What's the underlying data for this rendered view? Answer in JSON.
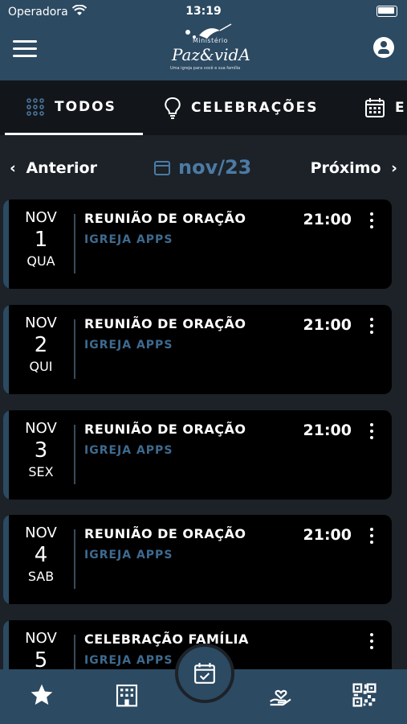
{
  "status": {
    "carrier": "Operadora",
    "time": "13:19"
  },
  "header": {
    "logo_small": "Ministério",
    "logo_main": "Paz&vidA",
    "logo_tagline": "Uma igreja para você e sua família"
  },
  "tabs": [
    {
      "label": "TODOS",
      "icon": "grid-icon",
      "active": true
    },
    {
      "label": "CELEBRAÇÕES",
      "icon": "lightbulb-icon"
    },
    {
      "label": "E",
      "icon": "calendar-icon"
    }
  ],
  "month_nav": {
    "prev": "Anterior",
    "current": "nov/23",
    "next": "Próximo"
  },
  "events": [
    {
      "month": "NOV",
      "day": "1",
      "weekday": "QUA",
      "title": "REUNIÃO DE ORAÇÃO",
      "subtitle": "IGREJA APPS",
      "time": "21:00"
    },
    {
      "month": "NOV",
      "day": "2",
      "weekday": "QUI",
      "title": "REUNIÃO DE ORAÇÃO",
      "subtitle": "IGREJA APPS",
      "time": "21:00"
    },
    {
      "month": "NOV",
      "day": "3",
      "weekday": "SEX",
      "title": "REUNIÃO DE ORAÇÃO",
      "subtitle": "IGREJA APPS",
      "time": "21:00"
    },
    {
      "month": "NOV",
      "day": "4",
      "weekday": "SAB",
      "title": "REUNIÃO DE ORAÇÃO",
      "subtitle": "IGREJA APPS",
      "time": "21:00"
    },
    {
      "month": "NOV",
      "day": "5",
      "weekday": "",
      "title": "CELEBRAÇÃO FAMÍLIA",
      "subtitle": "IGREJA APPS",
      "time": ""
    }
  ],
  "bottom_nav": [
    "star-icon",
    "building-icon",
    "calendar-check-icon",
    "heart-hand-icon",
    "qrcode-icon"
  ],
  "colors": {
    "accent": "#2c4a62",
    "link": "#4c7aa3",
    "background": "#1c2228"
  }
}
